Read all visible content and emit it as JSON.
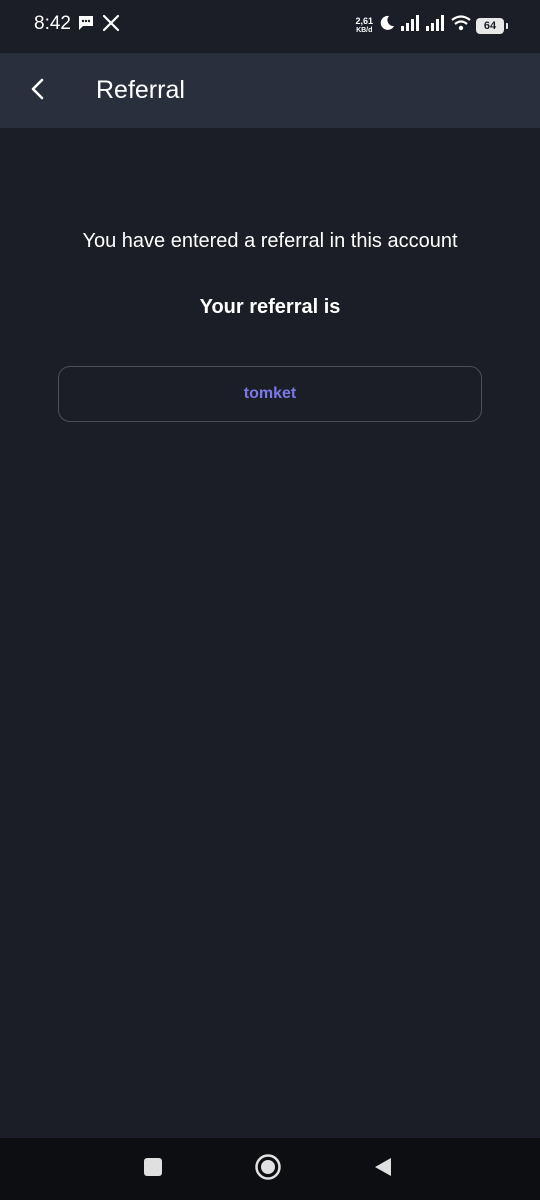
{
  "status_bar": {
    "time": "8:42",
    "net_speed_value": "2,61",
    "net_speed_unit": "KB/d",
    "battery": "64",
    "icons": [
      "message-icon",
      "x-logo-icon",
      "moon-icon",
      "signal-icon",
      "signal-icon",
      "wifi-icon",
      "battery-icon"
    ]
  },
  "app_bar": {
    "title": "Referral",
    "back_icon": "chevron-left-icon"
  },
  "content": {
    "message": "You have entered a referral in this account",
    "referral_heading": "Your referral is",
    "referral_code": "tomket"
  },
  "nav_bar": {
    "icons": [
      "recents-square-icon",
      "home-circle-icon",
      "back-triangle-icon"
    ]
  },
  "colors": {
    "background": "#1b1e26",
    "app_bar": "#2a2f3e",
    "accent": "#7b78e6",
    "nav_bar": "#0d0e12"
  }
}
